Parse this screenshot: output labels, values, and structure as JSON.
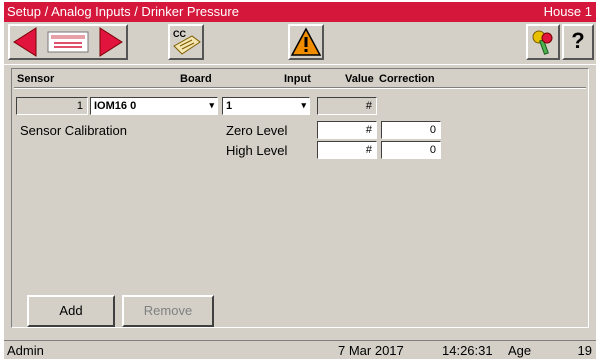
{
  "title_bar": {
    "breadcrumb": "Setup / Analog Inputs / Drinker Pressure",
    "house": "House 1"
  },
  "toolbar": {
    "back_icon": "red-left-arrow-icon",
    "list_icon": "list-view-icon",
    "forward_icon": "red-right-arrow-icon",
    "copy_icon": "cc-copy-icon",
    "alarm_icon": "warning-triangle-icon",
    "keys_icon": "keys-icon",
    "help_label": "?"
  },
  "columns": {
    "sensor": "Sensor",
    "board": "Board",
    "input": "Input",
    "value": "Value",
    "correction": "Correction"
  },
  "row": {
    "sensor_number": "1",
    "board": "IOM16 0",
    "input": "1",
    "value": "#"
  },
  "calibration": {
    "label": "Sensor Calibration",
    "zero_label": "Zero Level",
    "zero_value": "#",
    "zero_correction": "0",
    "high_label": "High Level",
    "high_value": "#",
    "high_correction": "0"
  },
  "buttons": {
    "add": "Add",
    "remove": "Remove"
  },
  "status": {
    "user": "Admin",
    "date": "7 Mar 2017",
    "time": "14:26:31",
    "age_label": "Age",
    "age_value": "19"
  },
  "colors": {
    "title_bar": "#d6173c",
    "panel": "#d4d0c8",
    "arrow_red": "#e0143c",
    "warning_orange": "#f08c00"
  }
}
